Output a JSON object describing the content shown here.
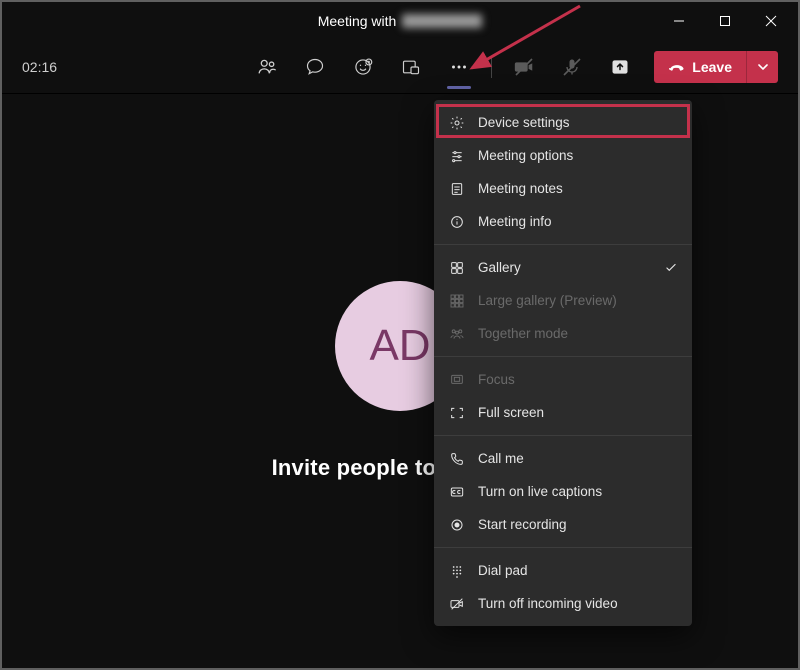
{
  "titlebar": {
    "title_prefix": "Meeting with "
  },
  "toolbar": {
    "timer": "02:16",
    "leave_label": "Leave"
  },
  "avatar": {
    "initials": "AD"
  },
  "main": {
    "invite_text": "Invite people to join you"
  },
  "menu": {
    "group1": [
      {
        "label": "Device settings"
      },
      {
        "label": "Meeting options"
      },
      {
        "label": "Meeting notes"
      },
      {
        "label": "Meeting info"
      }
    ],
    "group2": [
      {
        "label": "Gallery",
        "checked": true
      },
      {
        "label": "Large gallery (Preview)",
        "disabled": true
      },
      {
        "label": "Together mode",
        "disabled": true
      }
    ],
    "group3": [
      {
        "label": "Focus",
        "disabled": true
      },
      {
        "label": "Full screen"
      }
    ],
    "group4": [
      {
        "label": "Call me"
      },
      {
        "label": "Turn on live captions"
      },
      {
        "label": "Start recording"
      }
    ],
    "group5": [
      {
        "label": "Dial pad"
      },
      {
        "label": "Turn off incoming video"
      }
    ]
  }
}
